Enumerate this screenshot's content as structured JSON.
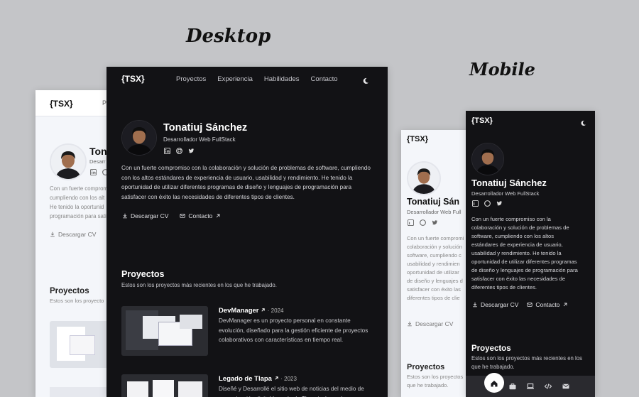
{
  "labels": {
    "desktop": "Desktop",
    "mobile": "Mobile"
  },
  "site": {
    "logo": "{TSX}",
    "nav": [
      "Proyectos",
      "Experiencia",
      "Habilidades",
      "Contacto"
    ],
    "name": "Tonatiuj Sánchez",
    "role": "Desarrollador Web FullStack",
    "bio": "Con un fuerte compromiso con la colaboración y solución de problemas de software, cumpliendo con los altos estándares de experiencia de usuario, usabilidad y rendimiento. He tenido la oportunidad de utilizar diferentes programas de diseño y lenguajes de programación para satisfacer con éxito las necesidades de diferentes tipos de clientes.",
    "cv_label": "Descargar CV",
    "contact_label": "Contacto",
    "projects_title": "Proyectos",
    "projects_subtitle": "Estos son los proyectos más recientes en los que he trabajado.",
    "projects": [
      {
        "title": "DevManager",
        "year": "· 2024",
        "desc": "DevManager es un proyecto personal en constante evolución, diseñado para la gestión eficiente de proyectos colaborativos con características en tiempo real."
      },
      {
        "title": "Legado de Tlapa",
        "year": "· 2023",
        "desc": "Diseñé y Desarrollé el sitio web de noticias del medio de comunicación digital Legado de Tlapa incluyendo"
      }
    ]
  },
  "light_desktop_partial": {
    "name": "Ton",
    "role": "Desarr",
    "nav_partial": "P",
    "bio_lines": [
      "Con un fuerte compromi",
      "cumpliendo con los alt",
      "He tenido la oportunid",
      "programación para sati"
    ],
    "cv_label": "Descargar CV",
    "projects_title": "Proyectos",
    "projects_subtitle": "Estos son los proyecto"
  },
  "light_mobile_partial": {
    "name": "Tonatiuj Sán",
    "role": "Desarrollador Web Full",
    "bio_lines": [
      "Con un fuerte compromi",
      "colaboración y solución",
      "software, cumpliendo c",
      "usabilidad y rendimien",
      "oportunidad de utilizar",
      "de diseño y lenguajes d",
      "satisfacer con éxito las",
      "diferentes tipos de clie"
    ],
    "cv_label": "Descargar CV",
    "projects_title": "Proyectos",
    "projects_subtitle": "Estos son los proyectos",
    "projects_subtitle_2": "que he trabajado."
  },
  "mobile_dark": {
    "bio_lines": [
      "Con un fuerte compromiso con la",
      "colaboración y solución de problemas de",
      "software, cumpliendo con los altos",
      "estándares de experiencia de usuario,",
      "usabilidad y rendimiento. He tenido la",
      "oportunidad de utilizar diferentes programas",
      "de diseño y lenguajes de programación para",
      "satisfacer con éxito las necesidades de",
      "diferentes tipos de clientes."
    ],
    "projects_subtitle_lines": [
      "Estos son los proyectos más recientes en los",
      "que he trabajado."
    ],
    "tabs": [
      "home-icon",
      "briefcase-icon",
      "laptop-icon",
      "code-icon",
      "mail-icon"
    ]
  },
  "colors": {
    "page_bg": "#c4c5c8",
    "dark_bg": "#121215",
    "light_bg": "#f4f6fa"
  }
}
